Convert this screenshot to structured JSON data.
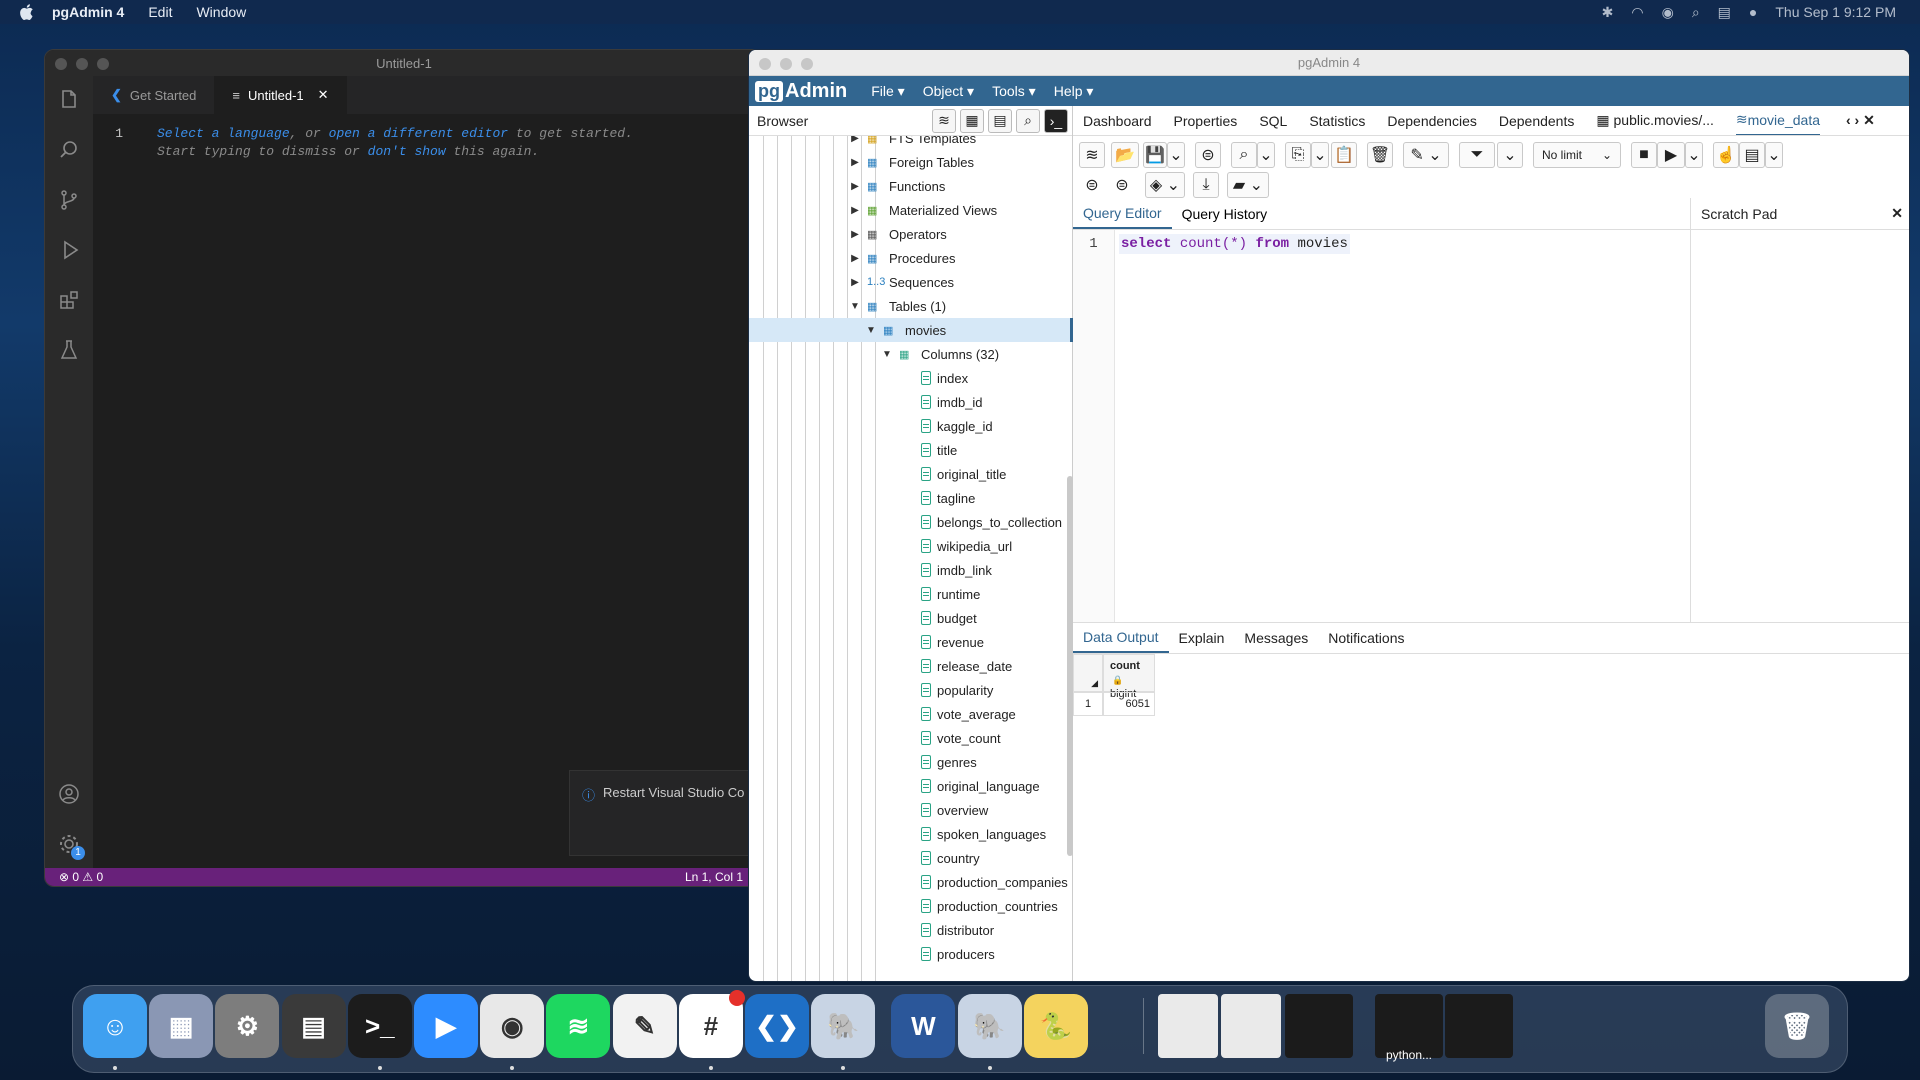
{
  "menubar": {
    "app": "pgAdmin 4",
    "items": [
      "Edit",
      "Window"
    ],
    "clock": "Thu Sep 1  9:12 PM"
  },
  "vscode": {
    "title": "Untitled-1",
    "tabs": [
      "Get Started",
      "Untitled-1"
    ],
    "line_number": "1",
    "hint1": {
      "a": "Select a language",
      "b": ", or ",
      "c": "open a different editor",
      "d": " to get started."
    },
    "hint2": {
      "a": "Start typing to dismiss or ",
      "b": "don't show",
      "c": " this again."
    },
    "notification": "Restart Visual Studio Co",
    "status": {
      "errors": "0",
      "warnings": "0",
      "position": "Ln 1, Col 1"
    },
    "badge": "1"
  },
  "pgadmin": {
    "title": "pgAdmin 4",
    "logo": {
      "pg": "pg",
      "rest": "Admin"
    },
    "menu": [
      "File",
      "Object",
      "Tools",
      "Help"
    ],
    "browser_label": "Browser",
    "tree": [
      {
        "label": "FTS Templates",
        "icon": "fts-templates-icon"
      },
      {
        "label": "Foreign Tables",
        "icon": "foreign-tables-icon"
      },
      {
        "label": "Functions",
        "icon": "functions-icon"
      },
      {
        "label": "Materialized Views",
        "icon": "materialized-views-icon"
      },
      {
        "label": "Operators",
        "icon": "operators-icon"
      },
      {
        "label": "Procedures",
        "icon": "procedures-icon"
      },
      {
        "label": "Sequences",
        "icon": "sequences-icon",
        "glyph": "1..3"
      },
      {
        "label": "Tables (1)",
        "icon": "tables-icon"
      },
      {
        "label": "movies",
        "icon": "table-icon"
      },
      {
        "label": "Columns (32)",
        "icon": "columns-icon"
      }
    ],
    "columns": [
      "index",
      "imdb_id",
      "kaggle_id",
      "title",
      "original_title",
      "tagline",
      "belongs_to_collection",
      "wikipedia_url",
      "imdb_link",
      "runtime",
      "budget",
      "revenue",
      "release_date",
      "popularity",
      "vote_average",
      "vote_count",
      "genres",
      "original_language",
      "overview",
      "spoken_languages",
      "country",
      "production_companies",
      "production_countries",
      "distributor",
      "producers"
    ],
    "main_tabs": [
      "Dashboard",
      "Properties",
      "SQL",
      "Statistics",
      "Dependencies",
      "Dependents",
      "public.movies/...",
      "movie_data"
    ],
    "limit": "No limit",
    "sql_tabs": [
      "Query Editor",
      "Query History"
    ],
    "scratch_pad": "Scratch Pad",
    "sql": {
      "line": "1",
      "kw1": "select",
      "fn": "count(*)",
      "kw2": "from",
      "table": "movies"
    },
    "output_tabs": [
      "Data Output",
      "Explain",
      "Messages",
      "Notifications"
    ],
    "result": {
      "col_name": "count",
      "col_type": "bigint",
      "row_num": "1",
      "value": "6051"
    }
  },
  "dock": {
    "apps": [
      "Finder",
      "Launchpad",
      "System Preferences",
      "Calculator",
      "Terminal",
      "Zoom",
      "Chrome",
      "Spotify",
      "TextEdit",
      "Slack",
      "VS Code",
      "pgAdmin 4",
      "Word",
      "pgAdmin 4",
      "Python Launcher"
    ],
    "python_label": "python...",
    "colors": {
      "accent": "#326690",
      "vscode_status": "#68217a"
    }
  }
}
